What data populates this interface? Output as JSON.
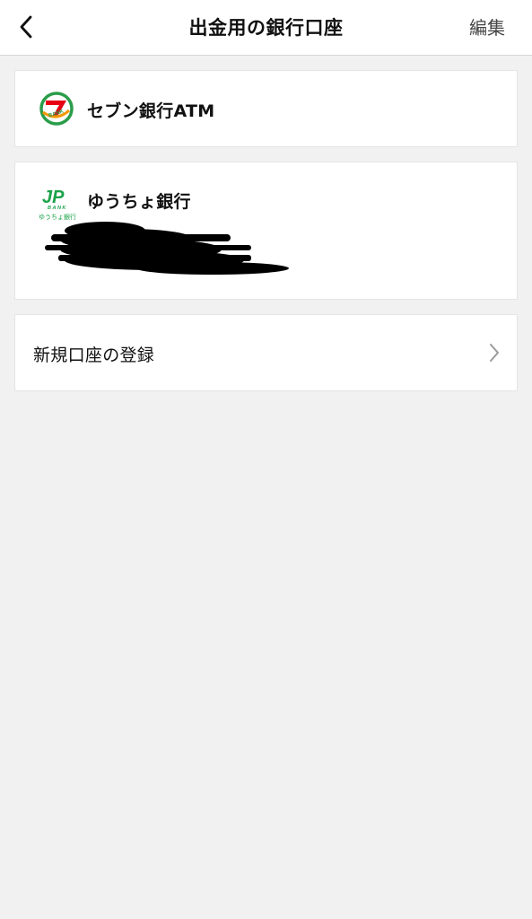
{
  "nav": {
    "back_icon": "chevron-left-icon",
    "title": "出金用の銀行口座",
    "edit_label": "編集"
  },
  "accounts": [
    {
      "name": "セブン銀行ATM",
      "logo": "seven-bank-logo",
      "logo_text": "BANK",
      "logo_color": "#e60012"
    },
    {
      "name": "ゆうちょ銀行",
      "logo": "jp-bank-logo",
      "logo_text": "JP",
      "logo_sub": "BANK",
      "logo_caption": "ゆうちょ銀行",
      "logo_color": "#1aa34a",
      "details_redacted": true
    }
  ],
  "register": {
    "label": "新規口座の登録",
    "icon": "chevron-right-icon"
  },
  "colors": {
    "nav_background": "#ffffff",
    "page_background": "#f1f1f1",
    "card_background": "#ffffff"
  }
}
